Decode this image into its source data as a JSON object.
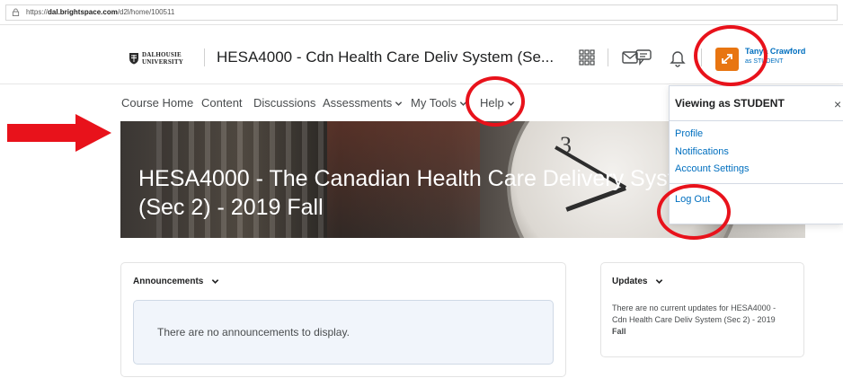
{
  "browser": {
    "url_prefix": "https://",
    "url_host": "dal.brightspace.com",
    "url_path": "/d2l/home/100511"
  },
  "minibar": {
    "logo_line1": "DALHOUSIE",
    "logo_line2": "UNIVERSITY",
    "course_title": "HESA4000 - Cdn Health Care Deliv System (Se...",
    "icons": [
      "course-selector-icon",
      "mail-icon",
      "chat-icon",
      "bell-icon"
    ],
    "user_name": "Tanya Crawford",
    "user_role": "as STUDENT",
    "avatar_color": "#e87511"
  },
  "navbar": {
    "items": [
      {
        "label": "Course Home"
      },
      {
        "label": "Content"
      },
      {
        "label": "Discussions"
      },
      {
        "label": "Assessments"
      },
      {
        "label": "My Tools"
      },
      {
        "label": "Help"
      }
    ]
  },
  "banner": {
    "title_line1": "HESA4000 - The Canadian Health Care Delivery System",
    "title_line2": "(Sec 2) - 2019 Fall",
    "clock_numeral": "3"
  },
  "announcements": {
    "heading": "Announcements",
    "empty_text": "There are no announcements to display."
  },
  "updates": {
    "heading": "Updates",
    "text_before": "There are no current updates for HESA4000 - Cdn Health Care Deliv System (Sec 2) - 2019 ",
    "text_bold": "Fall"
  },
  "user_menu": {
    "heading": "Viewing as STUDENT",
    "close_label": "×",
    "links": [
      {
        "label": "Profile"
      },
      {
        "label": "Notifications"
      },
      {
        "label": "Account Settings"
      }
    ],
    "logout_label": "Log Out"
  },
  "colors": {
    "annotation_red": "#e8121b",
    "link_blue": "#006fbf"
  }
}
